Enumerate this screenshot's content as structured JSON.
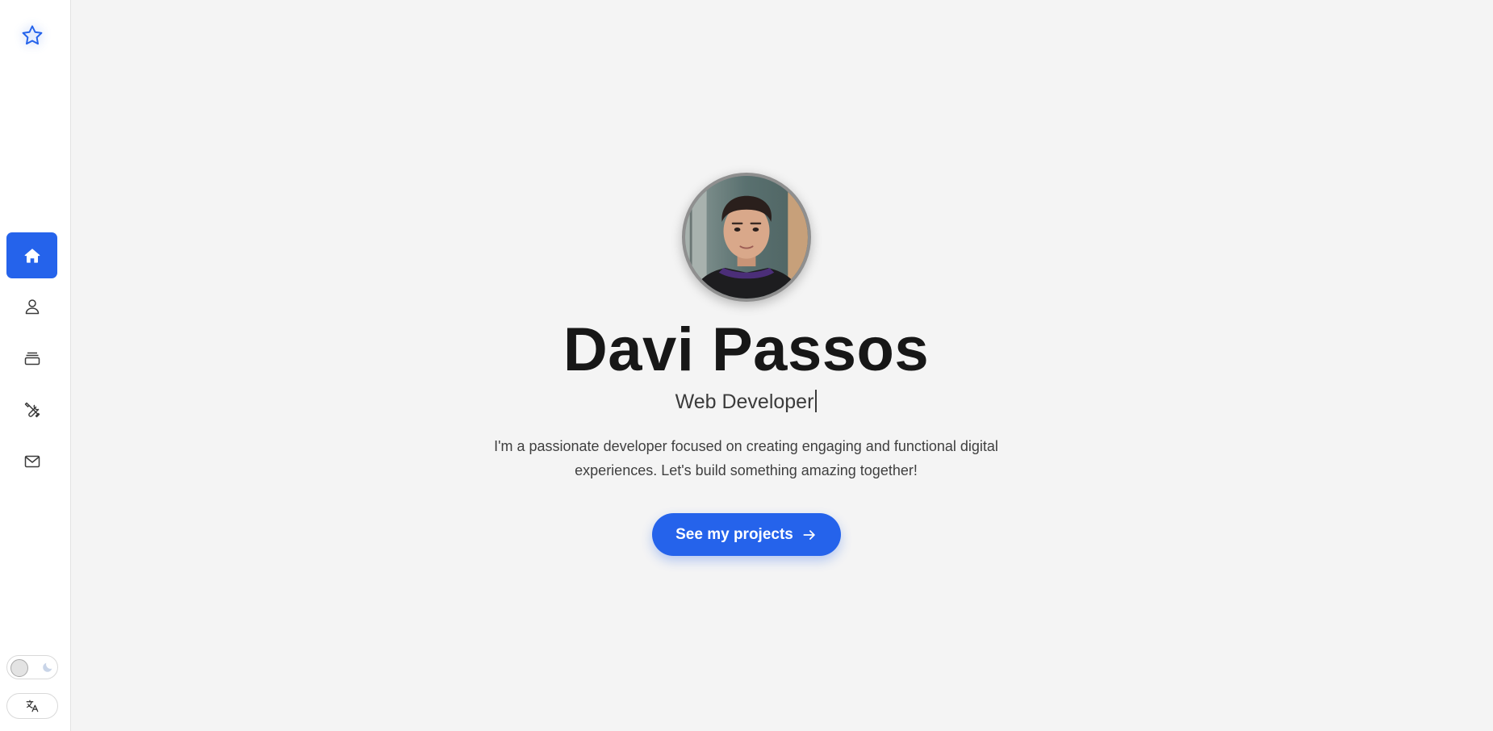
{
  "sidebar": {
    "logo_icon": "star-icon",
    "items": [
      {
        "id": "home",
        "icon": "home-icon",
        "active": true
      },
      {
        "id": "about",
        "icon": "user-icon",
        "active": false
      },
      {
        "id": "projects",
        "icon": "archive-icon",
        "active": false
      },
      {
        "id": "skills",
        "icon": "tools-icon",
        "active": false
      },
      {
        "id": "contact",
        "icon": "mail-icon",
        "active": false
      }
    ],
    "theme_toggle": {
      "state": "light",
      "icon": "moon-icon"
    },
    "language_button": {
      "icon": "translate-icon"
    }
  },
  "hero": {
    "name": "Davi Passos",
    "role": "Web Developer",
    "bio": "I'm a passionate developer focused on creating engaging and functional digital experiences. Let's build something amazing together!",
    "cta_label": "See my projects",
    "cta_icon": "arrow-right-icon"
  },
  "colors": {
    "accent": "#2563eb",
    "background": "#f4f4f4",
    "sidebar": "#ffffff",
    "text": "#171717"
  }
}
